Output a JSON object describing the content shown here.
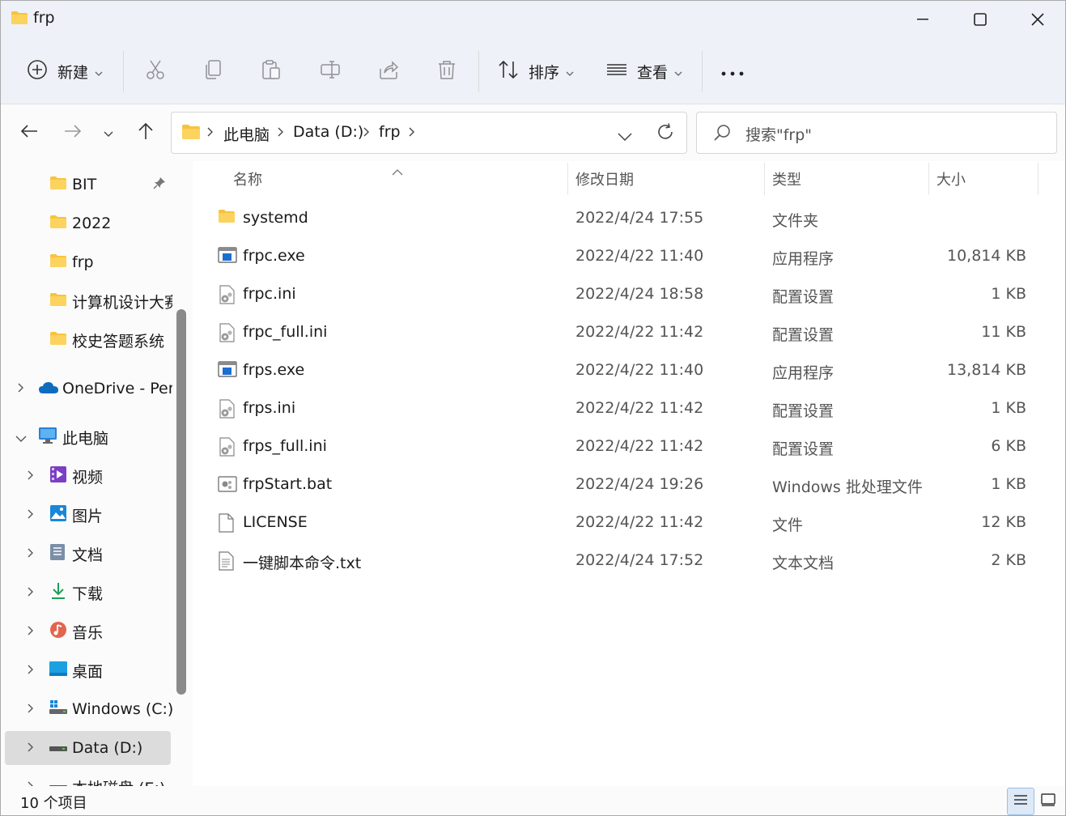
{
  "window": {
    "title": "frp",
    "accent": "#0067c0",
    "folder_color": "#f8c33c"
  },
  "commandbar": {
    "new_label": "新建",
    "sort_label": "排序",
    "view_label": "查看",
    "more_label": "···",
    "icons": [
      "cut-icon",
      "copy-icon",
      "paste-icon",
      "rename-icon",
      "share-icon",
      "delete-icon"
    ]
  },
  "address": {
    "crumbs": [
      "此电脑",
      "Data (D:)",
      "frp"
    ],
    "search_placeholder": "搜索\"frp\""
  },
  "sidebar": {
    "pinned": [
      {
        "label": "BIT",
        "pinned": true
      },
      {
        "label": "2022"
      },
      {
        "label": "frp"
      },
      {
        "label": "计算机设计大赛"
      },
      {
        "label": "校史答题系统"
      }
    ],
    "onedrive": "OneDrive - Personal",
    "thispc": "此电脑",
    "pc_items": [
      {
        "label": "视频",
        "icon": "video-icon"
      },
      {
        "label": "图片",
        "icon": "pictures-icon"
      },
      {
        "label": "文档",
        "icon": "documents-icon"
      },
      {
        "label": "下载",
        "icon": "download-icon"
      },
      {
        "label": "音乐",
        "icon": "music-icon"
      },
      {
        "label": "桌面",
        "icon": "desktop-icon"
      },
      {
        "label": "Windows (C:)",
        "icon": "windows-drive-icon"
      },
      {
        "label": "Data (D:)",
        "icon": "drive-icon",
        "selected": true
      },
      {
        "label": "本地磁盘 (E:)",
        "icon": "drive-icon"
      }
    ]
  },
  "columns": {
    "name": "名称",
    "date": "修改日期",
    "type": "类型",
    "size": "大小"
  },
  "files": [
    {
      "name": "systemd",
      "date": "2022/4/24 17:55",
      "type": "文件夹",
      "size": "",
      "icon": "folder-icon"
    },
    {
      "name": "frpc.exe",
      "date": "2022/4/22 11:40",
      "type": "应用程序",
      "size": "10,814 KB",
      "icon": "exe-icon"
    },
    {
      "name": "frpc.ini",
      "date": "2022/4/24 18:58",
      "type": "配置设置",
      "size": "1 KB",
      "icon": "ini-icon"
    },
    {
      "name": "frpc_full.ini",
      "date": "2022/4/22 11:42",
      "type": "配置设置",
      "size": "11 KB",
      "icon": "ini-icon"
    },
    {
      "name": "frps.exe",
      "date": "2022/4/22 11:40",
      "type": "应用程序",
      "size": "13,814 KB",
      "icon": "exe-icon"
    },
    {
      "name": "frps.ini",
      "date": "2022/4/22 11:42",
      "type": "配置设置",
      "size": "1 KB",
      "icon": "ini-icon"
    },
    {
      "name": "frps_full.ini",
      "date": "2022/4/22 11:42",
      "type": "配置设置",
      "size": "6 KB",
      "icon": "ini-icon"
    },
    {
      "name": "frpStart.bat",
      "date": "2022/4/24 19:26",
      "type": "Windows 批处理文件",
      "size": "1 KB",
      "icon": "bat-icon"
    },
    {
      "name": "LICENSE",
      "date": "2022/4/22 11:42",
      "type": "文件",
      "size": "12 KB",
      "icon": "file-icon"
    },
    {
      "name": "一键脚本命令.txt",
      "date": "2022/4/24 17:52",
      "type": "文本文档",
      "size": "2 KB",
      "icon": "txt-icon"
    }
  ],
  "status": {
    "count": "10 个项目"
  }
}
